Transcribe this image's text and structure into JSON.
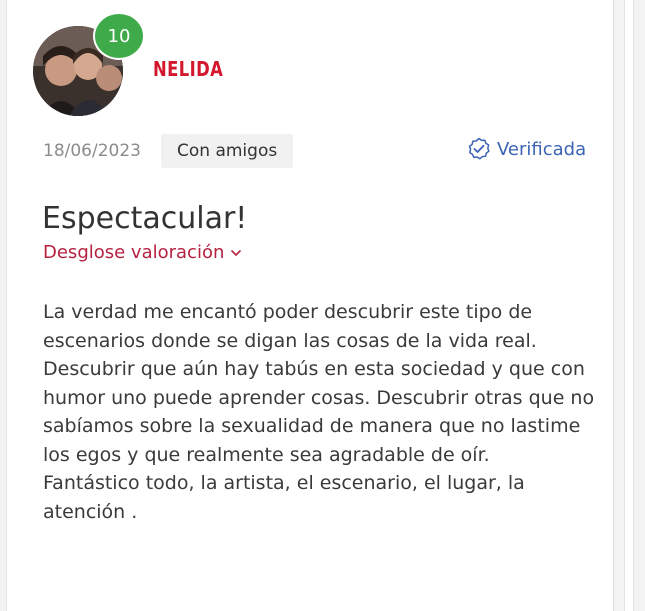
{
  "review": {
    "badge_count": "10",
    "username": "NELIDA",
    "date": "18/06/2023",
    "tag": "Con amigos",
    "verified_label": "Verificada",
    "title": "Espectacular!",
    "breakdown_label": "Desglose valoración",
    "body_paragraphs": [
      "La verdad me encantó poder descubrir este tipo de escenarios donde se digan las cosas de la vida real. Descubrir que aún hay tabús en esta sociedad y que con humor uno puede aprender cosas. Descubrir otras que no sabíamos sobre la sexualidad de manera que no lastime los egos y que realmente sea agradable de oír.",
      "Fantástico todo, la artista, el escenario, el lugar, la atención ."
    ]
  },
  "icons": {
    "verified": "check-circle-icon",
    "breakdown": "chevron-down-icon"
  },
  "colors": {
    "username": "#d3172d",
    "badge": "#3faa4a",
    "verified": "#3c63b5",
    "breakdown": "#b5213f"
  }
}
